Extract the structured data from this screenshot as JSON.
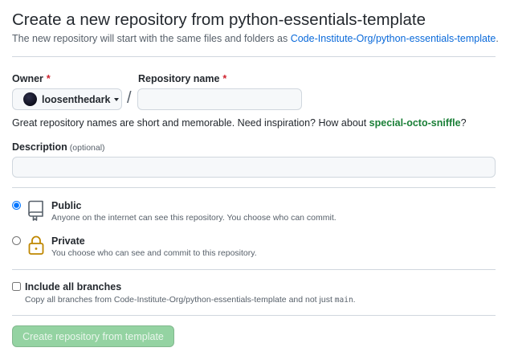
{
  "header": {
    "title": "Create a new repository from python-essentials-template",
    "subtitle_prefix": "The new repository will start with the same files and folders as ",
    "template_link": "Code-Institute-Org/python-essentials-template",
    "subtitle_suffix": "."
  },
  "owner": {
    "label": "Owner",
    "required_mark": "*",
    "selected": "loosenthedark"
  },
  "separator": "/",
  "repo_name": {
    "label": "Repository name",
    "required_mark": "*",
    "value": "",
    "placeholder": ""
  },
  "hint": {
    "text": "Great repository names are short and memorable. Need inspiration? How about ",
    "suggestion": "special-octo-sniffle",
    "suffix": "?"
  },
  "description": {
    "label": "Description",
    "optional": "(optional)",
    "value": "",
    "placeholder": ""
  },
  "visibility": {
    "selected": "public",
    "public": {
      "title": "Public",
      "note": "Anyone on the internet can see this repository. You choose who can commit.",
      "icon": "repo-icon"
    },
    "private": {
      "title": "Private",
      "note": "You choose who can see and commit to this repository.",
      "icon": "lock-icon"
    }
  },
  "include_branches": {
    "label": "Include all branches",
    "checked": false,
    "note_prefix": "Copy all branches from Code-Institute-Org/python-essentials-template and not just ",
    "note_code": "main",
    "note_suffix": "."
  },
  "submit": {
    "label": "Create repository from template",
    "disabled": true
  },
  "colors": {
    "link": "#0969da",
    "required": "#cf222e",
    "suggestion": "#1a7f37",
    "button_disabled": "#94d3a2",
    "radio_checked": "#0969da",
    "lock_icon": "#bf8700"
  }
}
